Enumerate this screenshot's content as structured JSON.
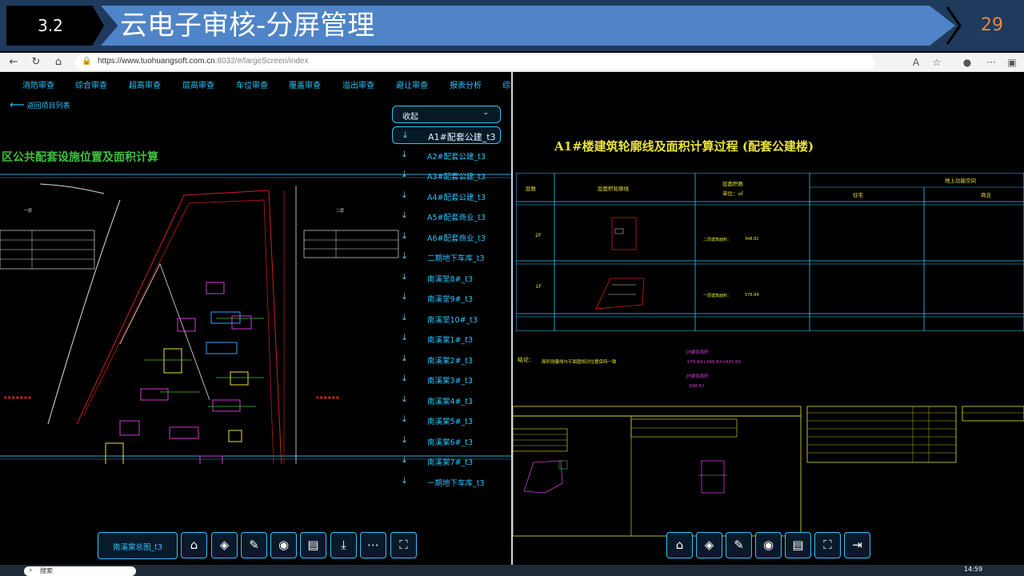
{
  "slide": {
    "section_number": "3.2",
    "title": "云电子审核-分屏管理",
    "page_number": "29"
  },
  "browser": {
    "url_host": "https://www.tuohuangsoft.com.cn",
    "url_path": ":8032/#/largeScreen/index",
    "icons": [
      "back-icon",
      "refresh-icon",
      "home-icon",
      "lock-icon",
      "read-aloud-icon",
      "favorite-icon",
      "profile-icon",
      "more-icon",
      "sidebar-icon"
    ]
  },
  "menu": {
    "items": [
      "消防审查",
      "综合审查",
      "超高审查",
      "层高审查",
      "车位审查",
      "覆盖审查",
      "溢出审查",
      "避让审查",
      "报表分析",
      "综"
    ]
  },
  "back_link": "返回项目列表",
  "left_drawing": {
    "title": "区公共配套设施位置及面积计算",
    "labels": [
      "一层",
      "二层"
    ]
  },
  "dropdown": {
    "label": "收起",
    "items": [
      "A1#配套公建_t3",
      "A2#配套公建_t3",
      "A3#配套公建_t3",
      "A4#配套公建_t3",
      "A5#配套商业_t3",
      "A6#配套商业_t3",
      "二期地下车库_t3",
      "南溪堂8#_t3",
      "南溪堂9#_t3",
      "南溪堂10#_t3",
      "南溪棠1#_t3",
      "南溪棠2#_t3",
      "南溪棠3#_t3",
      "南溪棠4#_t3",
      "南溪棠5#_t3",
      "南溪棠6#_t3",
      "南溪棠7#_t3",
      "一期地下车库_t3"
    ],
    "active_index": 0
  },
  "left_toolbar": {
    "current_file": "南溪棠总图_t3",
    "icons": [
      "home-icon",
      "layers-icon",
      "edit-icon",
      "eye-icon",
      "document-icon",
      "download-icon",
      "more-icon",
      "fullscreen-icon"
    ]
  },
  "right_toolbar": {
    "icons": [
      "home-icon",
      "layers-icon",
      "edit-icon",
      "eye-icon",
      "document-icon",
      "fullscreen-icon",
      "exit-icon"
    ]
  },
  "right_drawing": {
    "title": "A1#楼建筑轮廓线及面积计算过程 (配套公建楼)",
    "table": {
      "headers": [
        "层数",
        "层面积轮廓线",
        "层面积数",
        "地上功能空间",
        "住宅",
        "商业"
      ],
      "unit": "单位：㎡",
      "rows": [
        {
          "floor": "2F",
          "area_label": "二层建筑面积：",
          "area": "348.82"
        },
        {
          "floor": "1F",
          "area_label": "一层建筑面积：",
          "area": "576.84"
        }
      ]
    },
    "conclusion": "结论：",
    "conclusion_text": "面积测量线与平面图相对位置保持一致",
    "notes": [
      "1F建筑面积",
      "576.84+348.82=925.66",
      "2F建筑面积",
      "348.82"
    ]
  },
  "taskbar": {
    "search_placeholder": "搜索",
    "clock": "14:59"
  },
  "colors": {
    "accent": "#2fc4ff",
    "cad_yellow": "#e8e23a",
    "cad_magenta": "#d23ad2",
    "cad_green": "#3fc03f",
    "title_blue": "#4f84c8",
    "page_num": "#e88a3a"
  }
}
